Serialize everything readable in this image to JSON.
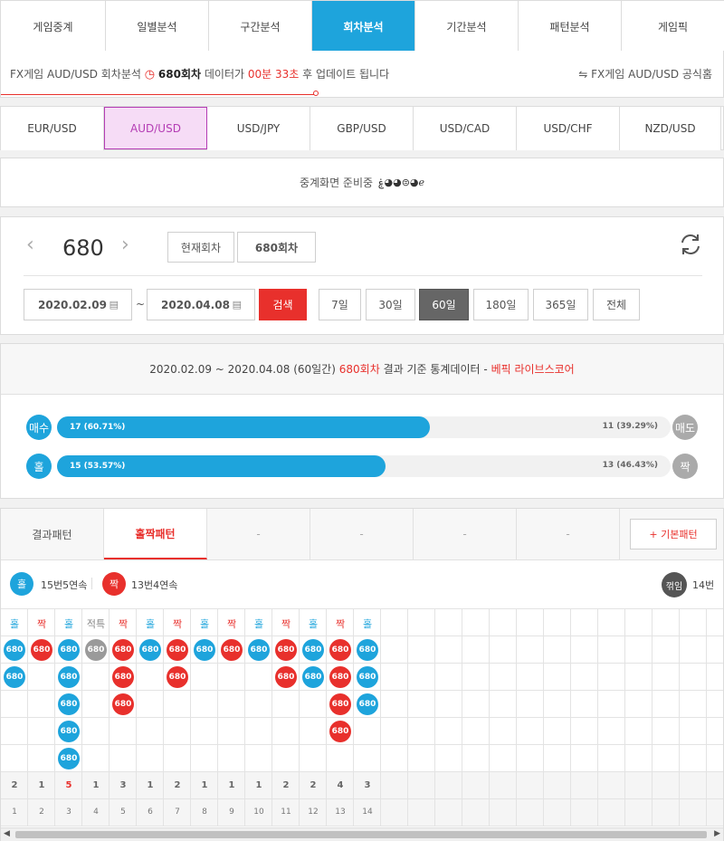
{
  "nav_tabs": [
    "게임중계",
    "일별분석",
    "구간분석",
    "회차분석",
    "기간분석",
    "패턴분석",
    "게임픽"
  ],
  "notice": {
    "prefix": "FX게임 AUD/USD 회차분석",
    "round": "680회차",
    "mid": "데이터가",
    "time": "00분 33초",
    "suffix": "후 업데이트 됩니다",
    "official": "FX게임 AUD/USD 공식홈"
  },
  "currencies": [
    "EUR/USD",
    "AUD/USD",
    "USD/JPY",
    "GBP/USD",
    "USD/CAD",
    "USD/CHF",
    "NZD/USD"
  ],
  "status_text": "중계화면 준비중",
  "round_nav": {
    "number": "680",
    "current_label": "현재회차",
    "current_value": "680회차"
  },
  "search": {
    "date_from": "2020.02.09",
    "tilde": "~",
    "date_to": "2020.04.08",
    "button": "검색",
    "periods": [
      "7일",
      "30일",
      "60일",
      "180일",
      "365일",
      "전체"
    ]
  },
  "summary": {
    "range": "2020.02.09 ~ 2020.04.08 (60일간)",
    "round": "680회차",
    "mid": "결과 기준 통계데이터",
    "dash": "-",
    "site": "베픽 라이브스코어"
  },
  "stats": [
    {
      "left_label": "매수",
      "left_text": "17 (60.71%)",
      "left_pct": 60.71,
      "right_text": "11 (39.29%)",
      "right_label": "매도"
    },
    {
      "left_label": "홀",
      "left_text": "15 (53.57%)",
      "left_pct": 53.57,
      "right_text": "13 (46.43%)",
      "right_label": "짝"
    }
  ],
  "pattern_tabs": [
    "결과패턴",
    "홀짝패턴",
    "-",
    "-",
    "-",
    "-"
  ],
  "pattern_button": "+ 기본패턴",
  "legend": {
    "odd_label": "홀",
    "odd_text": "15번5연속",
    "even_label": "짝",
    "even_text": "13번4연속",
    "turn_label": "꺾임",
    "turn_text": "14번"
  },
  "colors": {
    "blue": "#1ea4dc",
    "red": "#e8302c",
    "gray": "#9a9a9a",
    "dark": "#555555"
  },
  "grid": {
    "ball_label": "680",
    "columns": [
      {
        "head": "홀",
        "type": "odd",
        "n": 2,
        "count": "2",
        "idx": "1"
      },
      {
        "head": "짝",
        "type": "even",
        "n": 1,
        "count": "1",
        "idx": "2"
      },
      {
        "head": "홀",
        "type": "odd",
        "n": 5,
        "count": "5",
        "idx": "3",
        "hi": true
      },
      {
        "head": "적특",
        "type": "spec",
        "n": 1,
        "count": "1",
        "idx": "4"
      },
      {
        "head": "짝",
        "type": "even",
        "n": 3,
        "count": "3",
        "idx": "5"
      },
      {
        "head": "홀",
        "type": "odd",
        "n": 1,
        "count": "1",
        "idx": "6"
      },
      {
        "head": "짝",
        "type": "even",
        "n": 2,
        "count": "2",
        "idx": "7"
      },
      {
        "head": "홀",
        "type": "odd",
        "n": 1,
        "count": "1",
        "idx": "8"
      },
      {
        "head": "짝",
        "type": "even",
        "n": 1,
        "count": "1",
        "idx": "9"
      },
      {
        "head": "홀",
        "type": "odd",
        "n": 1,
        "count": "1",
        "idx": "10"
      },
      {
        "head": "짝",
        "type": "even",
        "n": 2,
        "count": "2",
        "idx": "11"
      },
      {
        "head": "홀",
        "type": "odd",
        "n": 2,
        "count": "2",
        "idx": "12"
      },
      {
        "head": "짝",
        "type": "even",
        "n": 4,
        "count": "4",
        "idx": "13"
      },
      {
        "head": "홀",
        "type": "odd",
        "n": 3,
        "count": "3",
        "idx": "14"
      }
    ]
  }
}
